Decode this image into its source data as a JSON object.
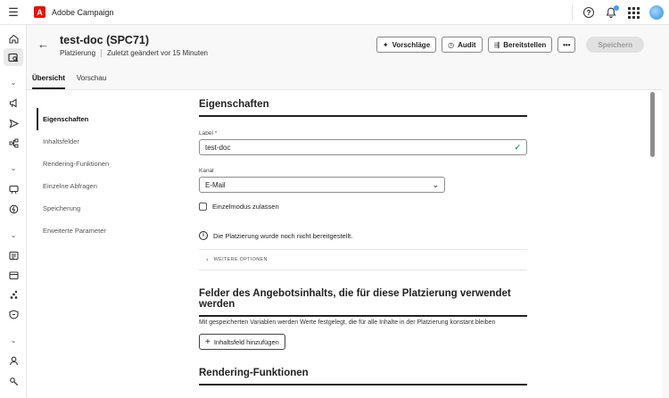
{
  "app": {
    "title": "Adobe Campaign",
    "logo_glyph": "A"
  },
  "topbar": {
    "icons": [
      "help-icon",
      "bell-icon",
      "apps-grid-icon",
      "avatar"
    ],
    "help_glyph": "?",
    "notification_dot_color": "#4b9cf5"
  },
  "rail": {
    "items": [
      "home-icon",
      "explorer-icon",
      "chevron-icon",
      "campaigns-icon",
      "deliveries-icon",
      "workflows-icon",
      "chevron-icon",
      "decisioning-icon",
      "offers-icon",
      "chevron-icon",
      "reports-icon",
      "content-icon",
      "audiences-icon",
      "badge-icon",
      "chevron-icon",
      "profile-icon",
      "settings-icon"
    ]
  },
  "header": {
    "title": "test-doc (SPC71)",
    "type": "Platzierung",
    "modified": "Zuletzt geändert vor 15 Minuten"
  },
  "actions": {
    "suggestions": "Vorschläge",
    "audit": "Audit",
    "deploy": "Bereitstellen",
    "more": "•••",
    "save": "Speichern"
  },
  "tabs": [
    {
      "label": "Übersicht",
      "active": true
    },
    {
      "label": "Vorschau",
      "active": false
    }
  ],
  "sidenav": [
    {
      "label": "Eigenschaften",
      "active": true
    },
    {
      "label": "Inhaltsfelder",
      "active": false
    },
    {
      "label": "Rendering-Funktionen",
      "active": false
    },
    {
      "label": "Einzelne Abfragen",
      "active": false
    },
    {
      "label": "Speicherung",
      "active": false
    },
    {
      "label": "Erweiterte Parameter",
      "active": false
    }
  ],
  "properties": {
    "title": "Eigenschaften",
    "label_field": {
      "label": "Label",
      "required_mark": "*",
      "value": "test-doc"
    },
    "channel_field": {
      "label": "Kanal",
      "value": "E-Mail"
    },
    "single_mode": {
      "label": "Einzelmodus zulassen",
      "checked": false
    },
    "info": "Die Platzierung wurde noch nicht bereitgestellt.",
    "more_options": "WEITERE OPTIONEN"
  },
  "content_fields": {
    "title": "Felder des Angebotsinhalts, die für diese Platzierung verwendet werden",
    "description": "Mit gespeicherten Variablen werden Werte festgelegt, die für alle Inhalte in der Platzierung konstant bleiben",
    "add_button": "Inhaltsfeld hinzufügen"
  },
  "rendering": {
    "title": "Rendering-Funktionen"
  }
}
